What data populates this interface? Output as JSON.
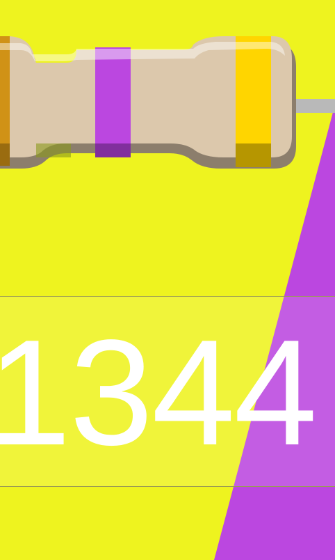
{
  "colors": {
    "background": "#eef31f",
    "accent": "#bb47e0",
    "resistor_body": "#dcc8ac",
    "resistor_shadow": "#8c7e6c",
    "lead": "#b9b9b9",
    "band_1": "#d09216",
    "band_2": "#bb47e0",
    "band_3": "#ffd500",
    "value_text": "#ffffff"
  },
  "resistor": {
    "bands": [
      "orange",
      "violet",
      "gold"
    ]
  },
  "display": {
    "value": "1344"
  }
}
